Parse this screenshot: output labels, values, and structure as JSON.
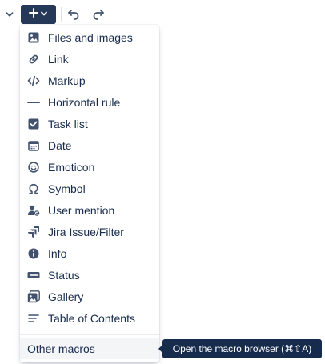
{
  "toolbar": {
    "insert_icon": "plus-icon",
    "undo_icon": "undo-icon",
    "redo_icon": "redo-icon"
  },
  "menu": {
    "items": [
      {
        "label": "Files and images",
        "icon": "image-icon"
      },
      {
        "label": "Link",
        "icon": "link-icon"
      },
      {
        "label": "Markup",
        "icon": "code-icon"
      },
      {
        "label": "Horizontal rule",
        "icon": "horizontal-rule-icon"
      },
      {
        "label": "Task list",
        "icon": "checkbox-icon"
      },
      {
        "label": "Date",
        "icon": "calendar-icon"
      },
      {
        "label": "Emoticon",
        "icon": "emoji-icon"
      },
      {
        "label": "Symbol",
        "icon": "omega-icon"
      },
      {
        "label": "User mention",
        "icon": "mention-icon"
      },
      {
        "label": "Jira Issue/Filter",
        "icon": "jira-icon"
      },
      {
        "label": "Info",
        "icon": "info-icon"
      },
      {
        "label": "Status",
        "icon": "status-icon"
      },
      {
        "label": "Gallery",
        "icon": "gallery-icon"
      },
      {
        "label": "Table of Contents",
        "icon": "toc-icon"
      }
    ],
    "other_macros_label": "Other macros"
  },
  "tooltip": {
    "text": "Open the macro browser (⌘⇧A)"
  },
  "colors": {
    "toolbar_active": "#253858",
    "text": "#172b4d",
    "icon": "#42526e",
    "hover": "#f4f5f7",
    "tooltip_bg": "#172b4d"
  }
}
